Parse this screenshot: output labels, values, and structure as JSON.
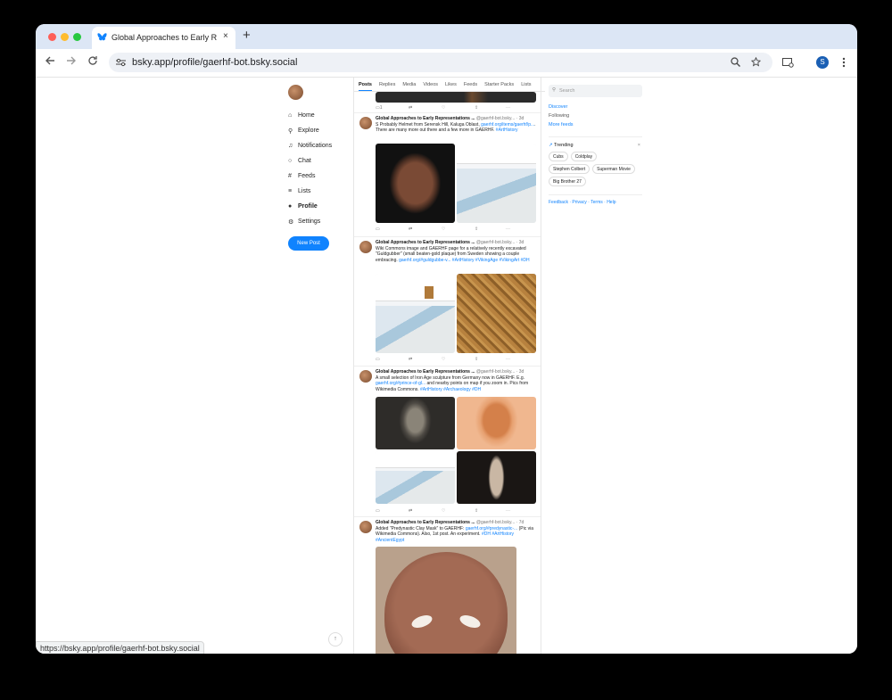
{
  "browser": {
    "tab_title": "Global Approaches to Early R",
    "close_glyph": "×",
    "newtab_glyph": "+",
    "url": "bsky.app/profile/gaerhf-bot.bsky.social",
    "profile_initial": "S",
    "status_url": "https://bsky.app/profile/gaerhf-bot.bsky.social"
  },
  "nav": {
    "items": [
      {
        "label": "Home",
        "icon": "⌂"
      },
      {
        "label": "Explore",
        "icon": "⚲"
      },
      {
        "label": "Notifications",
        "icon": "♫"
      },
      {
        "label": "Chat",
        "icon": "○"
      },
      {
        "label": "Feeds",
        "icon": "#"
      },
      {
        "label": "Lists",
        "icon": "≡"
      },
      {
        "label": "Profile",
        "icon": "●"
      },
      {
        "label": "Settings",
        "icon": "⚙"
      }
    ],
    "new_post": "New Post"
  },
  "profile_tabs": [
    "Posts",
    "Replies",
    "Media",
    "Videos",
    "Likes",
    "Feeds",
    "Starter Packs",
    "Lists"
  ],
  "posts": [
    {
      "author": "Global Approaches to Early Representations ...",
      "handle": "@gaerhf-bot.bsky...",
      "time": "· 3d",
      "text_pre": "S Probably Helmet from Serensk Hill, Kaluga Oblast,",
      "link": "gaerhf.org/items/gaerhf/p...",
      "text_post": ". There are many more out there and a few more in GAERHF.",
      "tags": "#ArtHistory",
      "reply_count": "1"
    },
    {
      "author": "Global Approaches to Early Representations ...",
      "handle": "@gaerhf-bot.bsky...",
      "time": "· 3d",
      "text_pre": "Wiki Commons image and GAERHF page for a relatively recently excavated \"Guldgubber\" (small beaten-gold plaque) from Sweden showing a couple embracing.",
      "link": "gaerhf.org/#guldgubbe-v...",
      "text_post": "",
      "tags": "#ArtHistory #VikingAge #VikingArt #DH",
      "reply_count": ""
    },
    {
      "author": "Global Approaches to Early Representations ...",
      "handle": "@gaerhf-bot.bsky...",
      "time": "· 3d",
      "text_pre": "A small selection of Iron Age sculpture from Germany now in GAERHF. E.g.",
      "link": "gaerhf.org/#prince-of-gl...",
      "text_post": "and nearby points on map if you zoom in. Pics from Wikimedia Commons.",
      "tags": "#ArtHistory #Archaeology #DH",
      "reply_count": ""
    },
    {
      "author": "Global Approaches to Early Representations ...",
      "handle": "@gaerhf-bot.bsky...",
      "time": "· 7d",
      "text_pre": "Added \"Predynastic Clay Mask\" to GAERHF:",
      "link": "gaerhf.org/#predynastic-...",
      "text_post": "(Pic via Wikimedia Commons). Also, 1st post. An experiment.",
      "tags": "#DH #ArtHistory #AncientEgypt",
      "reply_count": ""
    }
  ],
  "sidebar": {
    "search_placeholder": "Search",
    "links": [
      "Discover",
      "Following",
      "More feeds"
    ],
    "trending_label": "Trending",
    "trending_close": "×",
    "trending": [
      "Cubs",
      "Coldplay",
      "Stephen Colbert",
      "Superman Movie",
      "Big Brother 27"
    ],
    "footer": "Feedback · Privacy · Terms · Help"
  },
  "icons": {
    "back": "back-arrow-icon",
    "forward": "forward-arrow-icon",
    "reload": "reload-icon",
    "site_settings": "tune-icon",
    "zoom": "zoom-icon",
    "bookmark": "star-icon",
    "cast": "cast-icon",
    "menu": "kebab-menu-icon",
    "scroll_top": "arrow-up-icon"
  }
}
